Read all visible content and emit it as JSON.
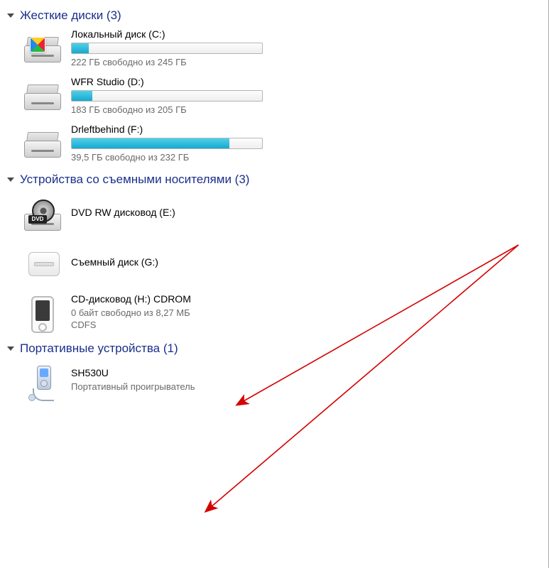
{
  "sections": {
    "hard_drives": {
      "title": "Жесткие диски (3)"
    },
    "removable": {
      "title": "Устройства со съемными носителями (3)"
    },
    "portable": {
      "title": "Портативные устройства (1)"
    }
  },
  "drives": {
    "c": {
      "name": "Локальный диск (C:)",
      "status": "222 ГБ свободно из 245 ГБ",
      "fill_pct": 9
    },
    "d": {
      "name": "WFR Studio (D:)",
      "status": "183 ГБ свободно из 205 ГБ",
      "fill_pct": 11
    },
    "f": {
      "name": "Drleftbehind (F:)",
      "status": "39,5 ГБ свободно из 232 ГБ",
      "fill_pct": 83
    }
  },
  "removable": {
    "e": {
      "name": "DVD RW дисковод (E:)",
      "badge": "DVD"
    },
    "g": {
      "name": "Съемный диск (G:)"
    },
    "h": {
      "name": "CD-дисковод (H:) CDROM",
      "status": "0 байт свободно из 8,27 МБ",
      "fs": "CDFS"
    }
  },
  "portable": {
    "sh": {
      "name": "SH530U",
      "desc": "Портативный проигрыватель"
    }
  }
}
